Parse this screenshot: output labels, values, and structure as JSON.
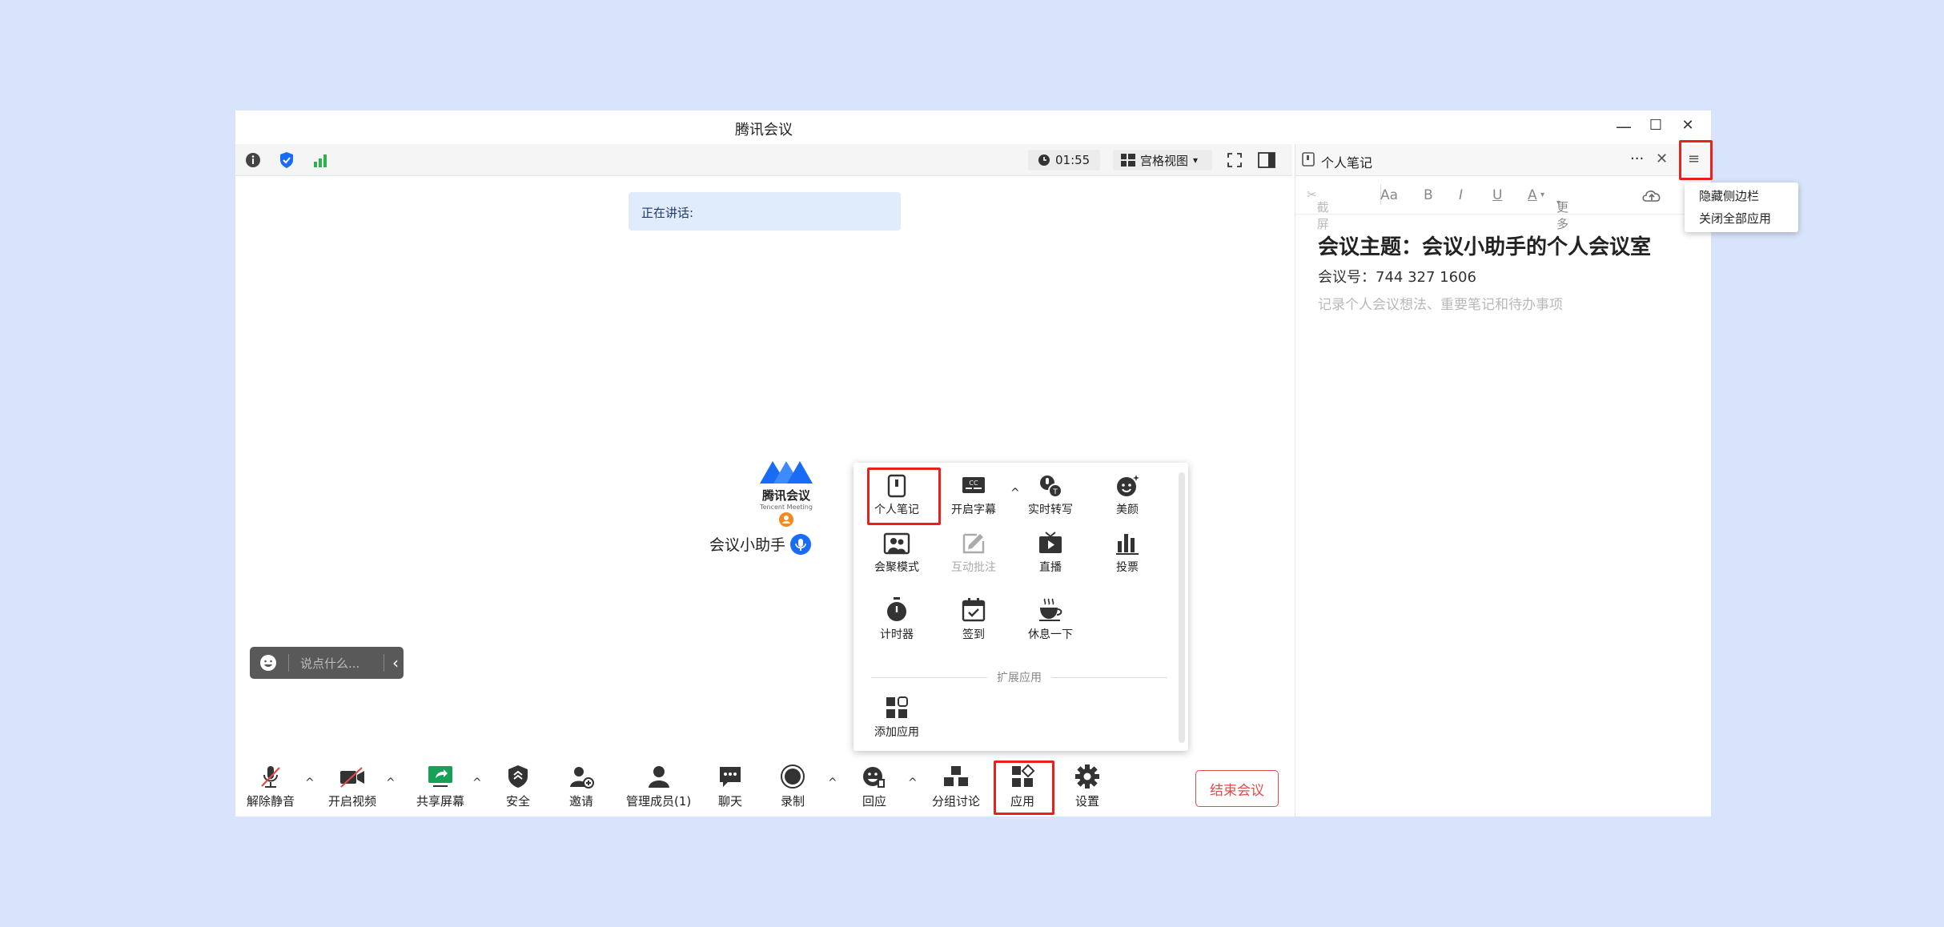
{
  "window": {
    "title": "腾讯会议",
    "minimize": "—",
    "maximize": "☐",
    "close": "✕"
  },
  "topbar": {
    "timer": "01:55",
    "view_label": "宫格视图",
    "view_caret": "▾"
  },
  "stage": {
    "speaking_label": "正在讲话:",
    "logo_text": "腾讯会议",
    "logo_subtext": "Tencent Meeting",
    "participant_name": "会议小助手",
    "chat_placeholder": "说点什么...",
    "chat_collapse": "‹"
  },
  "toolbar": {
    "items": [
      {
        "label": "解除静音",
        "icon": "mic-muted-icon"
      },
      {
        "label": "开启视频",
        "icon": "video-off-icon"
      },
      {
        "label": "共享屏幕",
        "icon": "share-screen-icon"
      },
      {
        "label": "安全",
        "icon": "shield-icon"
      },
      {
        "label": "邀请",
        "icon": "invite-icon"
      },
      {
        "label": "管理成员(1)",
        "icon": "members-icon"
      },
      {
        "label": "聊天",
        "icon": "chat-icon"
      },
      {
        "label": "录制",
        "icon": "record-icon"
      },
      {
        "label": "回应",
        "icon": "reaction-icon"
      },
      {
        "label": "分组讨论",
        "icon": "breakout-icon"
      },
      {
        "label": "应用",
        "icon": "apps-icon"
      },
      {
        "label": "设置",
        "icon": "gear-icon"
      }
    ],
    "caret": "^",
    "end_label": "结束会议"
  },
  "apps_popup": {
    "items": [
      {
        "label": "个人笔记",
        "icon": "notebook-icon",
        "enabled": true
      },
      {
        "label": "开启字幕",
        "icon": "captions-icon",
        "enabled": true
      },
      {
        "label": "实时转写",
        "icon": "transcribe-icon",
        "enabled": true
      },
      {
        "label": "美颜",
        "icon": "beauty-icon",
        "enabled": true
      },
      {
        "label": "会聚模式",
        "icon": "together-mode-icon",
        "enabled": true
      },
      {
        "label": "互动批注",
        "icon": "annotation-icon",
        "enabled": false
      },
      {
        "label": "直播",
        "icon": "live-icon",
        "enabled": true
      },
      {
        "label": "投票",
        "icon": "poll-icon",
        "enabled": true
      },
      {
        "label": "计时器",
        "icon": "stopwatch-icon",
        "enabled": true
      },
      {
        "label": "签到",
        "icon": "check-in-icon",
        "enabled": true
      },
      {
        "label": "休息一下",
        "icon": "coffee-icon",
        "enabled": true
      }
    ],
    "section_label": "扩展应用",
    "add_label": "添加应用"
  },
  "sidebar": {
    "title": "个人笔记",
    "more": "···",
    "close": "✕",
    "menu_icon": "≡",
    "toolbar": {
      "screenshot": "截屏",
      "font_size": "Aa",
      "bold": "B",
      "italic": "I",
      "underline": "U",
      "font_color": "A",
      "more": "更多"
    },
    "note_title": "会议主题：会议小助手的个人会议室",
    "meeting_id": "会议号：744 327 1606",
    "placeholder": "记录个人会议想法、重要笔记和待办事项"
  },
  "context_menu": {
    "items": [
      "隐藏侧边栏",
      "关闭全部应用"
    ]
  },
  "colors": {
    "highlight": "#e8211c",
    "accent": "#1a6cf5",
    "end": "#e04b4b",
    "background": "#d8e4fb"
  }
}
